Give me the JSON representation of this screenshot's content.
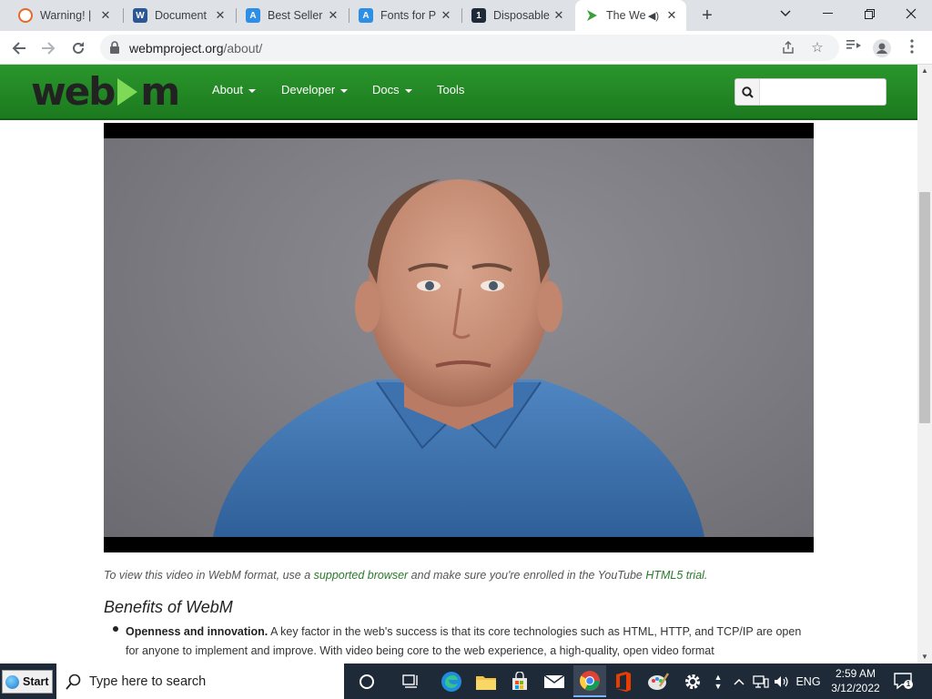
{
  "browser": {
    "tabs": [
      {
        "title": "Warning! |",
        "favicon": "brave-warning-icon",
        "color": "#e8682a",
        "active": false
      },
      {
        "title": "Document",
        "favicon": "word-icon",
        "color": "#2b5797",
        "active": false
      },
      {
        "title": "Best Seller",
        "favicon": "font-site-icon",
        "color": "#2d8ee6",
        "active": false
      },
      {
        "title": "Fonts for P",
        "favicon": "font-site-icon",
        "color": "#2d8ee6",
        "active": false
      },
      {
        "title": "Disposable",
        "favicon": "disposable-icon",
        "color": "#1f2a38",
        "active": false
      },
      {
        "title": "The We",
        "favicon": "webm-icon",
        "color": "#3aa03c",
        "active": true
      }
    ],
    "tab_glyphs": {
      "word": "W",
      "disposable": "1"
    },
    "url_host": "webmproject.org",
    "url_path": "/about/"
  },
  "site": {
    "logo_pre": "web",
    "logo_post": "m",
    "nav": [
      {
        "label": "About",
        "dropdown": true
      },
      {
        "label": "Developer",
        "dropdown": true
      },
      {
        "label": "Docs",
        "dropdown": true
      },
      {
        "label": "Tools",
        "dropdown": false
      }
    ],
    "search_placeholder": ""
  },
  "content": {
    "caption_1": "To view this video in WebM format, use a ",
    "caption_link_1": "supported browser",
    "caption_2": " and make sure you're enrolled in the YouTube ",
    "caption_link_2": "HTML5 trial",
    "caption_3": ".",
    "heading": "Benefits of WebM",
    "bullet_bold": "Openness and innovation.",
    "bullet_text": " A key factor in the web's success is that its core technologies such as HTML, HTTP, and TCP/IP are open for anyone to implement and improve. With video being core to the web experience, a high-quality, open video format"
  },
  "taskbar": {
    "start_label": "Start",
    "search_placeholder": "Type here to search",
    "language": "ENG",
    "time": "2:59 AM",
    "date": "3/12/2022",
    "notification_count": "1"
  },
  "colors": {
    "site_green": "#1f8a21",
    "link_green": "#2a7a2c"
  }
}
